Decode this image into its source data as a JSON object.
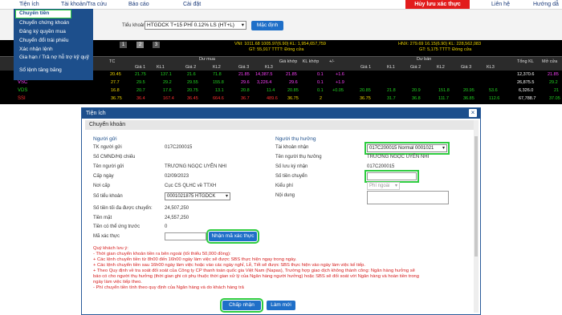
{
  "topmenu": {
    "tienich": "Tiện ích",
    "taikhoan": "Tài khoản/Tra cứu",
    "baocao": "Báo cáo",
    "caidat": "Cài đặt",
    "huylenh": "Hủy lưu xác thực",
    "lienhe": "Liên hệ",
    "huongdan": "Hướng dẫ"
  },
  "dropdown": {
    "items": [
      "Chuyển tiền",
      "Chuyển chứng khoán",
      "Đăng ký quyền mua",
      "Chuyển đổi trái phiếu",
      "Xác nhận lệnh",
      "Gia hạn / Trả nợ hỗ trợ kỹ quỹ",
      "Sổ lệnh tăng băng"
    ]
  },
  "account": {
    "label": "Tiểu khoản",
    "selected": "HTGDCK T+15 PHÍ 0.12% LS (HT+L)",
    "default_btn": "Mặc định"
  },
  "board": {
    "pages": [
      "1",
      "2",
      "3"
    ],
    "vni_line": "VNI: 1011.68 1005.97(6.90) KL: 1,954,657,759",
    "vni_gt": "GT: 55,917 TTTT: Đóng cửa",
    "hnx_line": "HNX: 279.69 16.15(6.90) KL: 228,562,083",
    "hnx_gt": "GT: 5,175 TTTT: Đóng cửa",
    "col_tc": "TC",
    "col_dumua": "Dư mua",
    "col_giakhop": "Giá khớp",
    "col_klkhop": "KL khớp",
    "col_pm": "+/-",
    "col_duban": "Dư bán",
    "col_tongkl": "Tổng KL",
    "col_mocua": "Mở cửa",
    "sub_gia1": "Giá 1",
    "sub_kl1": "KL1",
    "sub_gia2": "Giá 2",
    "sub_kl2": "KL2",
    "sub_gia3": "Giá 3",
    "sub_kl3": "KL3",
    "rows": [
      {
        "sym": "",
        "v1": "20.45",
        "v2": "21.75",
        "v3": "137.1",
        "v4": "21.6",
        "v5": "71.8",
        "v6": "21.85",
        "v7": "14,387.5",
        "v8": "21.85",
        "v9": "0.1",
        "v10": "+1.6",
        "tong": "12,370.6",
        "mo": "21.85"
      },
      {
        "sym": "VSC",
        "v1": "27.7",
        "v2": "29.5",
        "v3": "29.2",
        "v4": "29.55",
        "v5": "155.8",
        "v6": "29.6",
        "v7": "3,226.4",
        "v8": "29.6",
        "v9": "0.1",
        "v10": "+1.9",
        "tong": "26,875.5",
        "mo": "29.2"
      },
      {
        "sym": "VDS",
        "v1": "16.8",
        "v2": "20.7",
        "v3": "17.6",
        "v4": "20.75",
        "v5": "13.1",
        "v6": "20.8",
        "v7": "11.4",
        "v8": "20.85",
        "v9": "0.1",
        "v10": "+0.05",
        "tong": "6,326.0",
        "mo": "21"
      },
      {
        "sym": "SSI",
        "v1": "36.75",
        "v2": "36.4",
        "v3": "167.4",
        "v4": "36.45",
        "v5": "664.6",
        "v6": "36.7",
        "v7": "489.6",
        "v8": "36.75",
        "v9": "2",
        "v10": "",
        "tong": "67,788.7",
        "mo": "37.05"
      }
    ],
    "ask_rows": [
      [
        "",
        "",
        "",
        "",
        "",
        ""
      ],
      [
        "",
        "",
        "",
        "",
        "",
        ""
      ],
      [
        "20.85",
        "21.8",
        "20.9",
        "151.8",
        "20.95",
        "53.6"
      ],
      [
        "36.75",
        "31.7",
        "36.8",
        "111.7",
        "36.85",
        "112.6"
      ]
    ]
  },
  "modal": {
    "title": "Tiện ích",
    "subtitle": "Chuyển khoản",
    "sender_title": "Người gửi",
    "receiver_title": "Người thụ hưởng",
    "sender": {
      "tk_label": "TK người gửi",
      "tk_value": "017C200015",
      "cmnd_label": "Số CMND/Hộ chiếu",
      "cmnd_value": "",
      "ten_label": "Tên người gửi",
      "ten_value": "TRƯƠNG NGỌC UYÊN NHI",
      "capngay_label": "Cấp ngày",
      "capngay_value": "02/09/2023",
      "noicap_label": "Nơi cấp",
      "noicap_value": "Cục CS QLHC về TTXH",
      "tieukhoan_label": "Số tiểu khoản",
      "tieukhoan_value": "0001021875 HTGDCK",
      "toida_label": "Số tiền tối đa được chuyển:",
      "toida_value": "24,507,250",
      "tienmat_label": "Tiền mặt",
      "tienmat_value": "24,557,250",
      "ungtruoc_label": "Tiền có thể ứng trước",
      "ungtruoc_value": "0",
      "maxacthuc_label": "Mã xác thực",
      "maxacthuc_btn": "Nhận mã xác thực"
    },
    "receiver": {
      "tkn_label": "Tài khoản nhận",
      "tkn_value": "017C200015 Normal 0001021",
      "ten_label": "Tên người thụ hưởng",
      "ten_value": "TRƯƠNG NGỌC UYÊN NHI",
      "luuky_label": "Số lưu ký nhận",
      "luuky_value": "017C200015",
      "sotien_label": "Số tiền chuyển",
      "sotien_value": "",
      "kieuphi_label": "Kiểu phí",
      "kieuphi_value": "Phí ngoài",
      "noidung_label": "Nội dung",
      "noidung_value": ""
    },
    "notes": [
      "Quý khách lưu ý:",
      "- Thời gian chuyển khoản tiền ra bên ngoài (tối thiểu 50,000 đồng):",
      "+ Các lệnh chuyển tiền từ 8h00 đến 16h00 ngày làm việc sẽ được SBS thực hiện ngay trong ngày.",
      "+ Các lệnh chuyển tiền sau 16h00 ngày làm việc hoặc vào các ngày nghỉ, Lễ, Tết sẽ được SBS thực hiện vào ngày làm việc kế tiếp.",
      "+ Theo Quy định về tra soát đối soát của Công ty CP thanh toán quốc gia Việt Nam (Napas), Trường hợp giao dịch không thành công: Ngân hàng hưởng sẽ",
      "báo có cho người thụ hưởng (thời gian ghi có phụ thuộc thời gian xử lý của Ngân hàng người hưởng) hoặc SBS sẽ đối soát với Ngân hàng và hoàn tiền trong",
      "ngày làm việc tiếp theo.",
      "- Phí chuyển tiền tính theo quy định của Ngân hàng và do khách hàng trả"
    ],
    "accept_btn": "Chấp nhận",
    "reset_btn": "Làm mới",
    "close_icon": "×"
  }
}
